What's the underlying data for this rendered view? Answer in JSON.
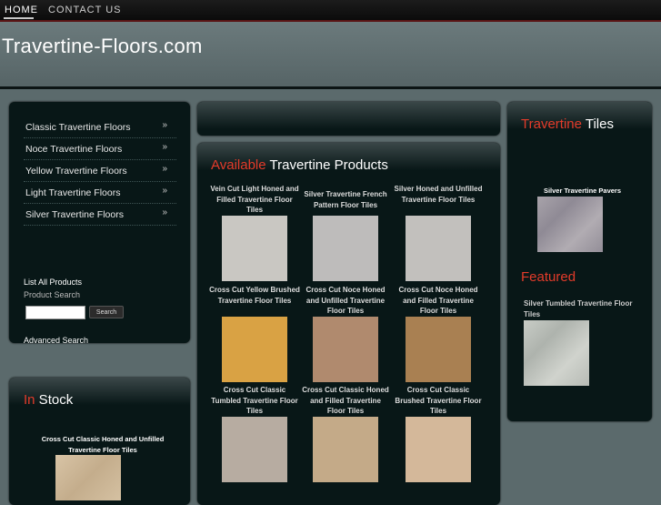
{
  "nav": {
    "home": "HOME",
    "contact": "CONTACT US"
  },
  "site": {
    "title": "Travertine-Floors.com"
  },
  "categories": [
    {
      "label": "Classic Travertine Floors",
      "arrow": "»"
    },
    {
      "label": "Noce Travertine Floors",
      "arrow": "»"
    },
    {
      "label": "Yellow Travertine Floors",
      "arrow": "»"
    },
    {
      "label": "Light Travertine Floors",
      "arrow": "»"
    },
    {
      "label": "Silver Travertine Floors",
      "arrow": "»"
    }
  ],
  "search": {
    "list_all": "List All Products",
    "label": "Product Search",
    "button": "Search",
    "advanced": "Advanced Search",
    "value": ""
  },
  "in_stock": {
    "heading_red": "In",
    "heading_rest": " Stock",
    "item_title": "Cross Cut Classic Honed and Unfilled Travertine Floor Tiles"
  },
  "available": {
    "heading_red": "Available",
    "heading_rest": " Travertine Products",
    "products": [
      {
        "title": "Vein Cut Light Honed and Filled Travertine Floor Tiles",
        "color": "#c9c7c2"
      },
      {
        "title": "Silver Travertine French Pattern Floor Tiles",
        "color": "#bebcbb"
      },
      {
        "title": "Silver Honed and Unfilled Travertine Floor Tiles",
        "color": "#c2c0bd"
      },
      {
        "title": "Cross Cut Yellow Brushed Travertine Floor Tiles",
        "color": "#d9a244"
      },
      {
        "title": "Cross Cut Noce Honed and Unfilled Travertine Floor Tiles",
        "color": "#b08a6e"
      },
      {
        "title": "Cross Cut Noce Honed and Filled Travertine Floor Tiles",
        "color": "#a98052"
      },
      {
        "title": "Cross Cut Classic Tumbled Travertine Floor Tiles",
        "color": "#b7aca1"
      },
      {
        "title": "Cross Cut Classic Honed and Filled Travertine Floor Tiles",
        "color": "#c4aa88"
      },
      {
        "title": "Cross Cut Classic Brushed Travertine Floor Tiles",
        "color": "#d4b89a"
      }
    ]
  },
  "tiles": {
    "heading_red": "Travertine",
    "heading_rest": " Tiles",
    "pavers_title": "Silver Travertine Pavers"
  },
  "featured": {
    "heading": "Featured",
    "title": "Silver Tumbled Travertine Floor Tiles"
  }
}
